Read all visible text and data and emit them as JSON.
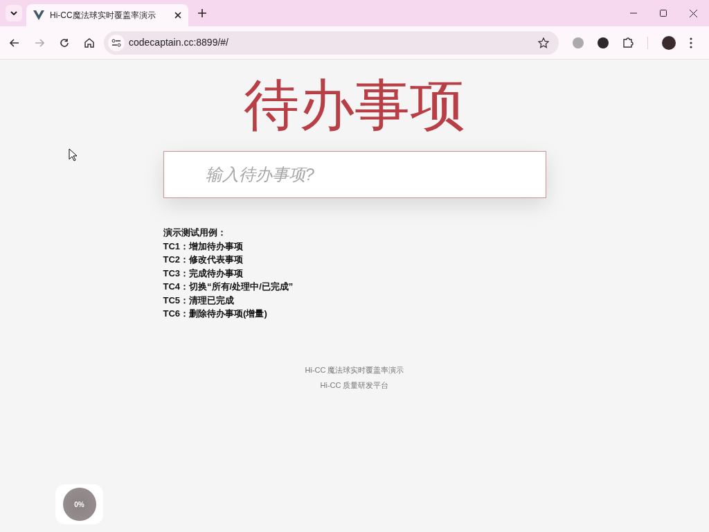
{
  "browser": {
    "tab": {
      "title": "Hi-CC魔法球实时覆盖率演示",
      "selected": true
    },
    "url": "codecaptain.cc:8899/#/"
  },
  "page": {
    "title": "待办事项",
    "input": {
      "placeholder": "输入待办事项?"
    },
    "test_cases": {
      "heading": "演示测试用例：",
      "items": [
        {
          "id": "TC1：",
          "text": "增加待办事项"
        },
        {
          "id": "TC2：",
          "text": "修改代表事项"
        },
        {
          "id": "TC3：",
          "text": "完成待办事项"
        },
        {
          "id": "TC4：",
          "text": "切换“所有/处理中/已完成”"
        },
        {
          "id": "TC5：",
          "text": "清理已完成"
        },
        {
          "id": "TC6：",
          "text": "删除待办事项(增量)"
        }
      ]
    },
    "footer": [
      "Hi-CC 魔法球实时覆盖率演示",
      "Hi-CC 质量研发平台"
    ],
    "coverage_widget": {
      "reading": "0%"
    }
  }
}
